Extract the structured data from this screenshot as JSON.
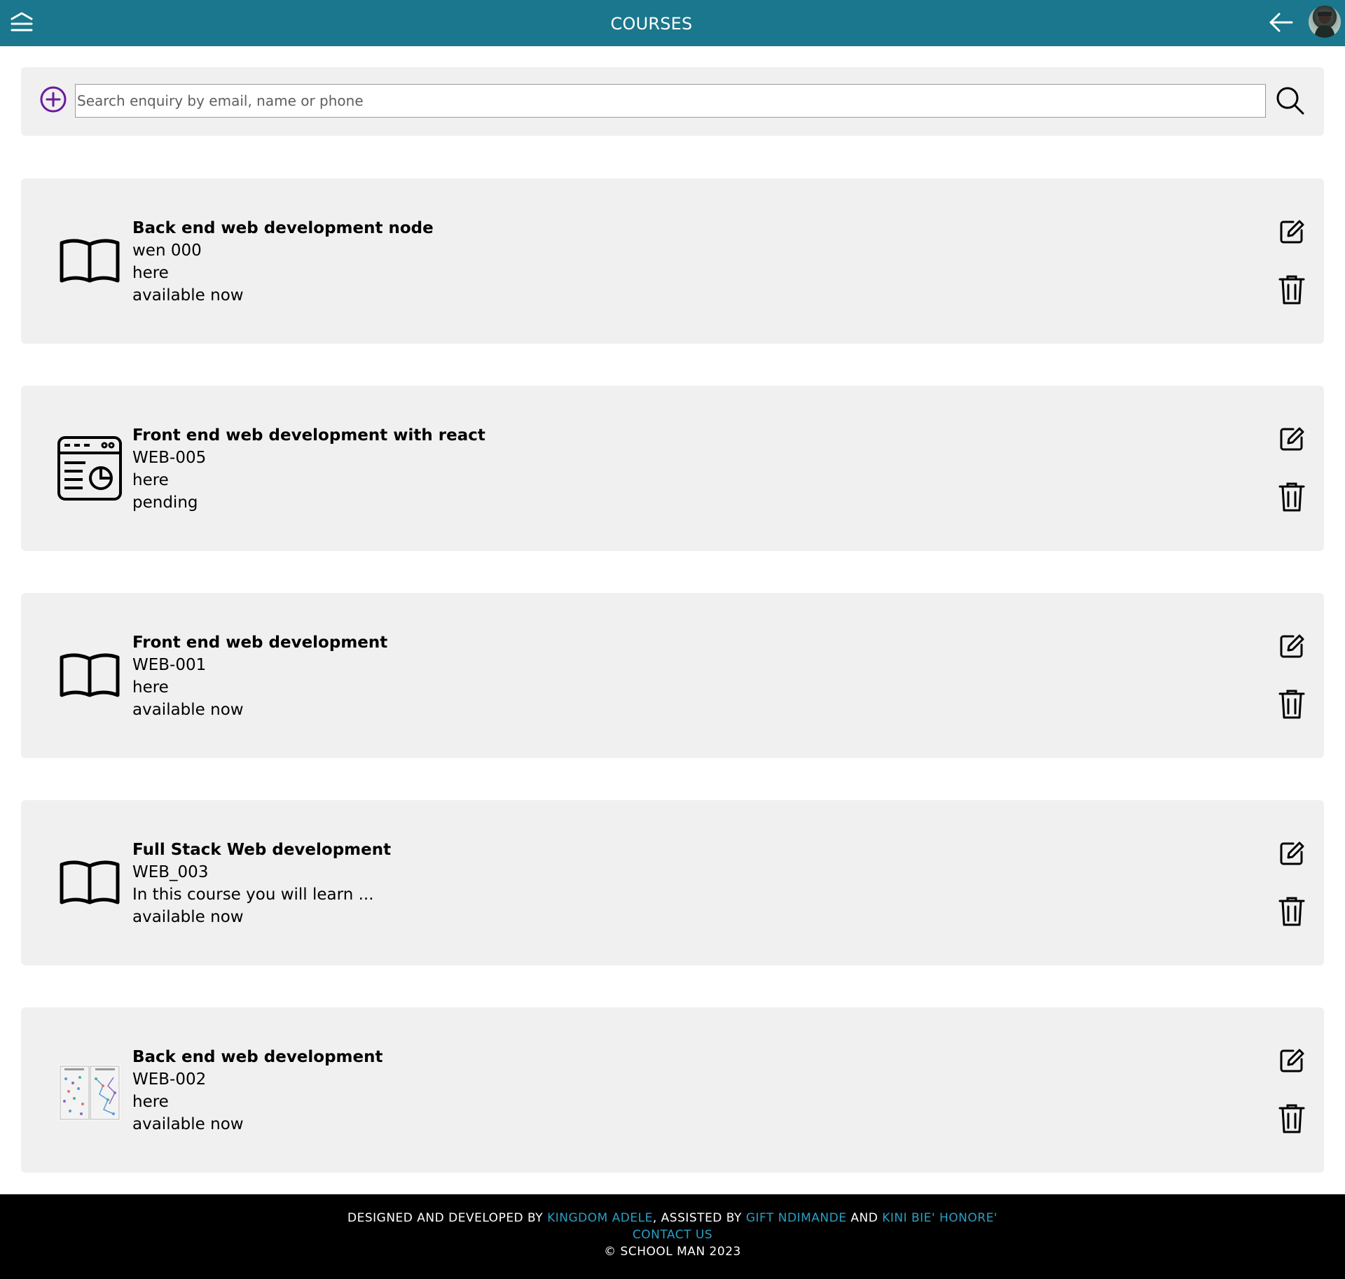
{
  "header": {
    "title": "COURSES",
    "menu_icon": "menu-icon",
    "back_icon": "arrow-left-icon",
    "avatar": "user-avatar",
    "background_color": "#1a778d"
  },
  "search": {
    "placeholder": "Search enquiry by email, name or phone",
    "value": "",
    "add_icon": "plus-circle-icon",
    "search_icon": "search-icon",
    "add_icon_color": "#6a1b9a"
  },
  "courses": [
    {
      "name": "Back end web development node",
      "code": "wen 000",
      "description": "here",
      "status": "available now",
      "icon": "open-book-icon"
    },
    {
      "name": "Front end web development with react",
      "code": "WEB-005",
      "description": "here",
      "status": "pending",
      "icon": "web-dashboard-icon"
    },
    {
      "name": "Front end web development",
      "code": "WEB-001",
      "description": "here",
      "status": "available now",
      "icon": "open-book-icon"
    },
    {
      "name": "Full Stack Web development",
      "code": "WEB_003",
      "description": "In this course you will learn ...",
      "status": "available now",
      "icon": "open-book-icon"
    },
    {
      "name": "Back end web development",
      "code": "WEB-002",
      "description": "here",
      "status": "available now",
      "icon": "course-thumbnail-image"
    }
  ],
  "actions": {
    "edit_icon": "edit-icon",
    "delete_icon": "trash-icon"
  },
  "footer": {
    "designed_prefix": "DESIGNED AND DEVELOPED BY ",
    "developer": "KINGDOM ADELE",
    "assisted_prefix": ", ASSISTED BY ",
    "assistant_1": "GIFT NDIMANDE",
    "and": " AND ",
    "assistant_2": "KINI BIE' HONORE'",
    "contact": "CONTACT US",
    "copyright": "© SCHOOL MAN 2023",
    "link_color": "#2a9fc4"
  }
}
